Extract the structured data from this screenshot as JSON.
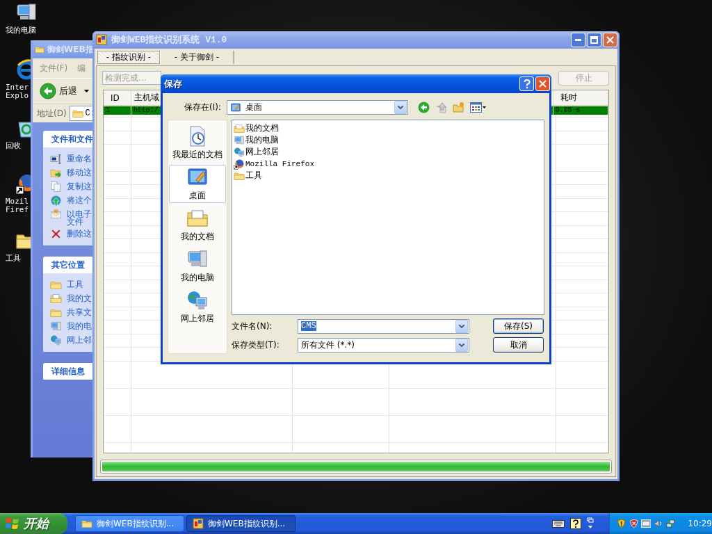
{
  "desktop_icons": [
    {
      "kind": "computer",
      "label": "我的电脑"
    },
    {
      "kind": "browser",
      "label": "Inter\nExplo"
    },
    {
      "kind": "recycle",
      "label": "回收"
    },
    {
      "kind": "firefox",
      "label": "Mozil\nFiref"
    },
    {
      "kind": "folder",
      "label": "工具"
    }
  ],
  "explorer_window": {
    "title": "御剑WEB指",
    "menu": [
      "文件(F)",
      "编"
    ],
    "back_button": "后退",
    "address_label": "地址(D)",
    "address": "C:",
    "panels": [
      {
        "title": "文件和文件",
        "items": [
          {
            "kind": "rename",
            "label": "重命名"
          },
          {
            "kind": "move",
            "label": "移动这"
          },
          {
            "kind": "copy",
            "label": "复制这"
          },
          {
            "kind": "publish",
            "label": "将这个"
          },
          {
            "kind": "email",
            "label": "以电子文件"
          },
          {
            "kind": "delete",
            "label": "删除这"
          }
        ]
      },
      {
        "title": "其它位置",
        "items": [
          {
            "kind": "folder",
            "label": "工具"
          },
          {
            "kind": "documents",
            "label": "我的文"
          },
          {
            "kind": "folder",
            "label": "共享文"
          },
          {
            "kind": "computer",
            "label": "我的电"
          },
          {
            "kind": "network",
            "label": "网上邻"
          }
        ]
      },
      {
        "title": "详细信息"
      }
    ]
  },
  "main_window": {
    "title": "御剑WEB指纹识别系统 V1.0",
    "tabs": [
      {
        "label": "- 指纹识别 -",
        "selected": true
      },
      {
        "label": "- 关于御剑 -",
        "selected": false
      }
    ],
    "status": "检测完成...",
    "stop_button": {
      "label": "停止",
      "disabled": true
    },
    "table": {
      "columns": [
        "ID",
        "主机域",
        "耗时"
      ],
      "rows": [
        {
          "cells": [
            "1",
            "http:/",
            "0.05 s"
          ],
          "selected": true
        }
      ]
    },
    "progress": {
      "level": 1
    }
  },
  "save_dialog": {
    "title": "保存",
    "save_in_label": "保存在(I):",
    "save_in": "桌面",
    "places": [
      {
        "kind": "recent",
        "label": "我最近的文档",
        "selected": false
      },
      {
        "kind": "desktop",
        "label": "桌面",
        "selected": true
      },
      {
        "kind": "documents",
        "label": "我的文档",
        "selected": false
      },
      {
        "kind": "computer",
        "label": "我的电脑",
        "selected": false
      },
      {
        "kind": "network",
        "label": "网上邻居",
        "selected": false
      }
    ],
    "files": [
      {
        "kind": "documents",
        "label": "我的文档"
      },
      {
        "kind": "computer",
        "label": "我的电脑"
      },
      {
        "kind": "network",
        "label": "网上邻居"
      },
      {
        "kind": "firefox",
        "label": "Mozilla Firefox"
      },
      {
        "kind": "folder",
        "label": "工具"
      }
    ],
    "filename_label": "文件名(N):",
    "filename": {
      "value": "CMS",
      "selected": true
    },
    "filetype_label": "保存类型(T):",
    "filetype": "所有文件 (*.*)",
    "save_button": "保存(S)",
    "cancel_button": "取消"
  },
  "taskbar": {
    "start": "开始",
    "tasks": [
      {
        "kind": "folder",
        "label": "御剑WEB指纹识别...",
        "selected": false
      },
      {
        "kind": "app",
        "label": "御剑WEB指纹识别...",
        "selected": true
      }
    ],
    "clock": "10:29"
  }
}
